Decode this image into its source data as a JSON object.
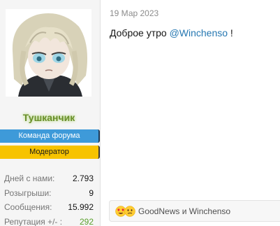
{
  "post": {
    "date": "19 Мар 2023",
    "message": {
      "before": "Доброе утро ",
      "mention": "@Winchenso",
      "after": " !"
    }
  },
  "user": {
    "username": "Тушканчик",
    "banners": {
      "team": "Команда форума",
      "moderator": "Модератор"
    },
    "stats": [
      {
        "label": "Дней с нами:",
        "value": "2.793"
      },
      {
        "label": "Розыгрыши:",
        "value": "9"
      },
      {
        "label": "Сообщения:",
        "value": "15.992"
      },
      {
        "label": "Репутация +/- :",
        "value": "292"
      }
    ]
  },
  "reactions": {
    "icons": [
      "heart-eyes-emoji-icon",
      "confused-emoji-icon"
    ],
    "text": "GoodNews и Winchenso"
  },
  "colors": {
    "username": "#6a8f2c",
    "team_banner": "#3e9ad9",
    "moderator_banner": "#f7c300",
    "mention": "#2577b1",
    "reputation_positive": "#5aa02c"
  }
}
